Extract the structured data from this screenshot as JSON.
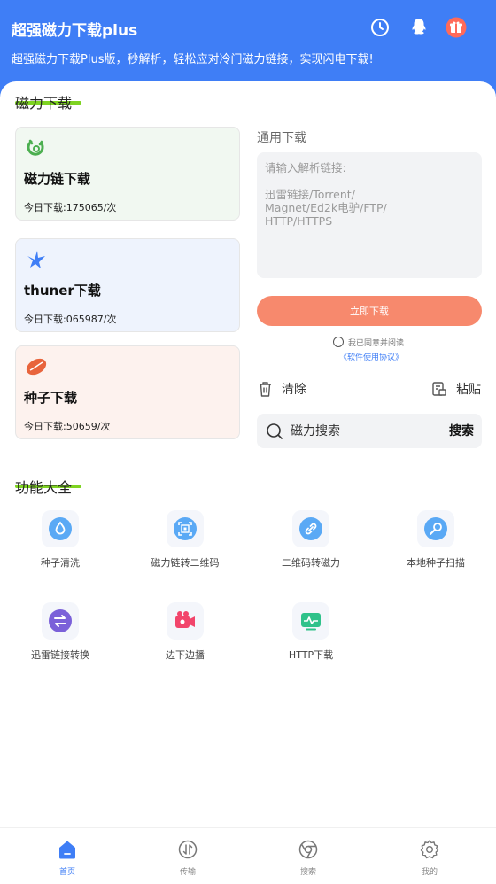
{
  "header": {
    "title": "超强磁力下载plus",
    "subtitle": "超强磁力下载Plus版，秒解析，轻松应对冷门磁力链接，实现闪电下载!",
    "icons": [
      "history-icon",
      "qq-icon",
      "gift-icon"
    ]
  },
  "magnet_section": {
    "title": "磁力下载",
    "cards": [
      {
        "title": "磁力链下载",
        "count": "今日下载:175065/次",
        "icon": "magnet-icon",
        "bg": "#f1f8f1",
        "accent": "#4caf50"
      },
      {
        "title": "thuner下载",
        "count": "今日下载:065987/次",
        "icon": "thunder-bird-icon",
        "bg": "#eef3fd",
        "accent": "#3f7ef6"
      },
      {
        "title": "种子下载",
        "count": "今日下载:50659/次",
        "icon": "seed-icon",
        "bg": "#fdf2ee",
        "accent": "#e8643c"
      }
    ]
  },
  "general_download": {
    "label": "通用下载",
    "placeholder": "请输入解析链接:\n\n迅雷链接/Torrent/\nMagnet/Ed2k电驴/FTP/\nHTTP/HTTPS",
    "button": "立即下载",
    "agree_text": "我已同意并阅读",
    "agree_link": "《软件使用协议》",
    "clear": "清除",
    "paste": "粘贴"
  },
  "search": {
    "placeholder": "磁力搜索",
    "button": "搜索"
  },
  "features": {
    "title": "功能大全",
    "items": [
      {
        "label": "种子清洗",
        "icon": "seed-wash-icon"
      },
      {
        "label": "磁力链转二维码",
        "icon": "qr-code-icon"
      },
      {
        "label": "二维码转磁力",
        "icon": "link-icon"
      },
      {
        "label": "本地种子扫描",
        "icon": "local-scan-icon"
      },
      {
        "label": "迅雷链接转换",
        "icon": "convert-icon"
      },
      {
        "label": "边下边播",
        "icon": "video-icon"
      },
      {
        "label": "HTTP下载",
        "icon": "http-icon"
      }
    ]
  },
  "bottom_nav": [
    {
      "label": "首页",
      "icon": "home-icon",
      "active": true
    },
    {
      "label": "传输",
      "icon": "transfer-icon",
      "active": false
    },
    {
      "label": "搜索",
      "icon": "browser-icon",
      "active": false
    },
    {
      "label": "我的",
      "icon": "settings-icon",
      "active": false
    }
  ],
  "colors": {
    "primary": "#3f7ef6",
    "accent_green": "#7ed321",
    "download_button": "#f7896d"
  }
}
